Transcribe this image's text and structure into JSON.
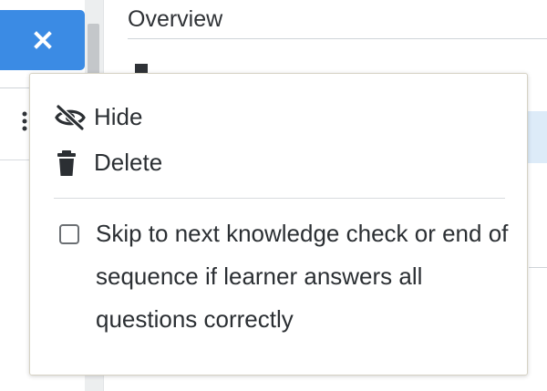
{
  "page": {
    "title": "Overview"
  },
  "toolbar": {
    "close_icon": "close-icon",
    "more_icon": "kebab-icon"
  },
  "menu": {
    "items": [
      {
        "label": "Hide",
        "icon": "eye-slash-icon"
      },
      {
        "label": "Delete",
        "icon": "trash-icon"
      }
    ],
    "skip_option": {
      "label": "Skip to next knowledge check or end of sequence if learner answers all questions correctly",
      "checked": false
    }
  },
  "colors": {
    "accent": "#3b8be4",
    "text": "#2b2f33",
    "highlight": "#ddebf8",
    "popover_border": "#d6d2c4"
  }
}
